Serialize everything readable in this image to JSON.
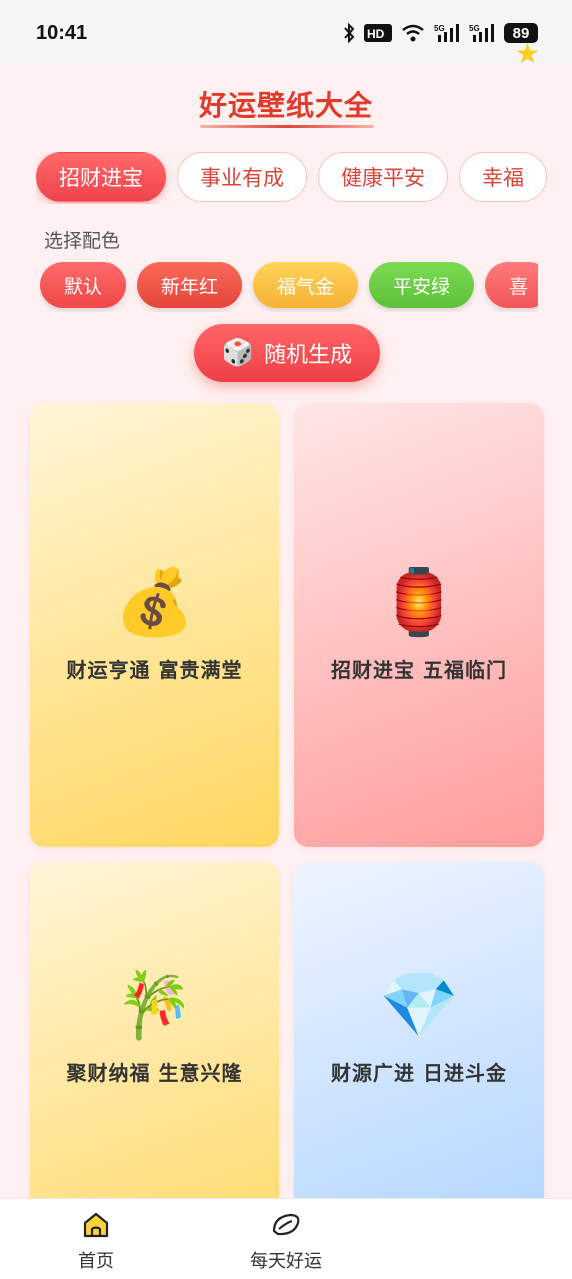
{
  "status_bar": {
    "time": "10:41",
    "battery": "89",
    "icons": [
      "bluetooth-icon",
      "hd-icon",
      "wifi-icon",
      "signal-5g-icon",
      "signal-5g-icon",
      "battery-icon"
    ]
  },
  "header": {
    "title": "好运壁纸大全"
  },
  "tabs": [
    {
      "label": "招财进宝",
      "active": true
    },
    {
      "label": "事业有成",
      "active": false
    },
    {
      "label": "健康平安",
      "active": false
    },
    {
      "label": "幸福",
      "active": false
    }
  ],
  "color_section": {
    "label": "选择配色",
    "options": [
      {
        "label": "默认",
        "color": "#f04848"
      },
      {
        "label": "新年红",
        "color": "#e5453a"
      },
      {
        "label": "福气金",
        "color": "#f5b336"
      },
      {
        "label": "平安绿",
        "color": "#5cc23a"
      },
      {
        "label": "喜",
        "color": "#f25656"
      }
    ]
  },
  "random_button": {
    "label": "随机生成",
    "icon": "dice-icon"
  },
  "cards": [
    {
      "emoji": "💰",
      "icon": "money-bag-icon",
      "text": "财运亨通 富贵满堂"
    },
    {
      "emoji": "🏮",
      "icon": "lantern-icon",
      "text": "招财进宝 五福临门"
    },
    {
      "emoji": "🎋",
      "icon": "tanabata-tree-icon",
      "text": "聚财纳福 生意兴隆"
    },
    {
      "emoji": "💎",
      "icon": "gem-icon",
      "text": "财源广进 日进斗金"
    }
  ],
  "bottom_nav": [
    {
      "label": "首页",
      "icon": "home-icon",
      "active": true
    },
    {
      "label": "每天好运",
      "icon": "leaf-icon",
      "active": false
    }
  ],
  "colors": {
    "accent": "#e23a2a",
    "background": "#fff1f1"
  }
}
